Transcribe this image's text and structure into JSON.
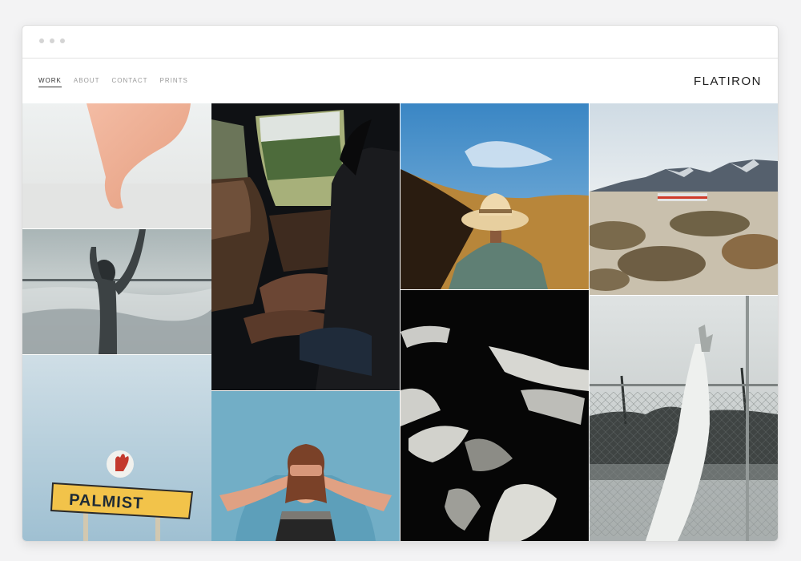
{
  "window": {
    "controls": [
      "close",
      "minimize",
      "zoom"
    ]
  },
  "site": {
    "brand": "FLATIRON",
    "nav": [
      {
        "label": "WORK",
        "active": true
      },
      {
        "label": "ABOUT",
        "active": false
      },
      {
        "label": "CONTACT",
        "active": false
      },
      {
        "label": "PRINTS",
        "active": false
      }
    ]
  },
  "gallery": {
    "photos": [
      {
        "subject": "peach fabric in wind"
      },
      {
        "subject": "woman splashing in ocean"
      },
      {
        "subject": "palmist sign",
        "sign_text": "PALMIST"
      },
      {
        "subject": "woman in car"
      },
      {
        "subject": "woman covering eyes"
      },
      {
        "subject": "man in straw hat on hill"
      },
      {
        "subject": "hands on black"
      },
      {
        "subject": "desert mountains with trailer"
      },
      {
        "subject": "arm with fabric by fence"
      }
    ]
  },
  "colors": {
    "accent": "#333333",
    "nav_muted": "#9a9a9a",
    "window_bg": "#ffffff"
  }
}
